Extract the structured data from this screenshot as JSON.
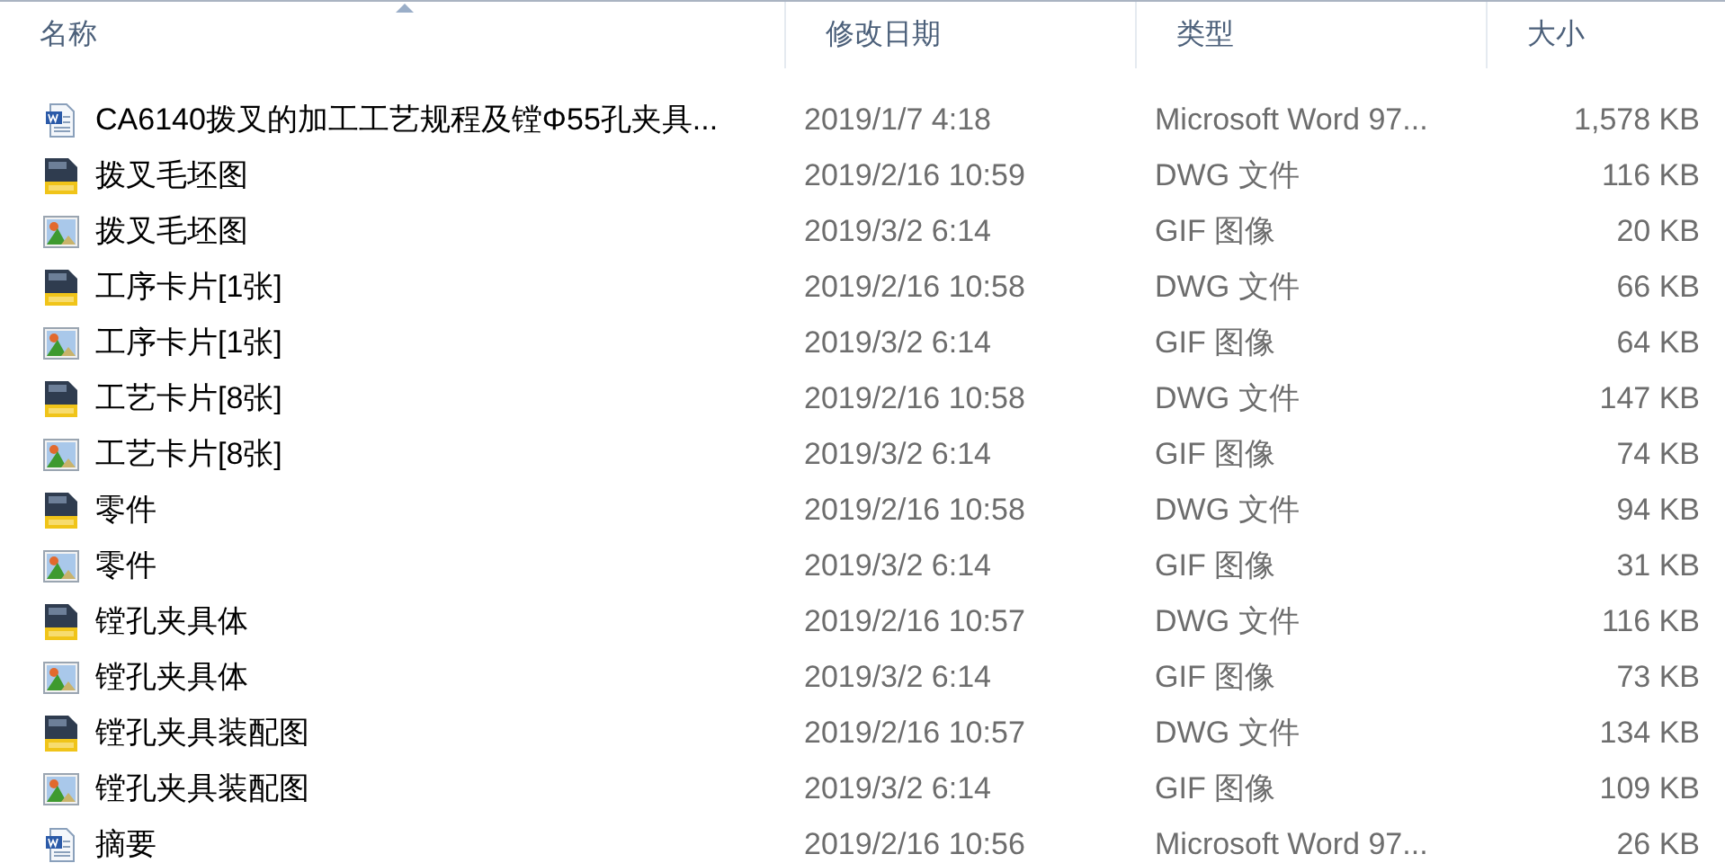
{
  "columns": [
    {
      "label": "名称",
      "sorted": true
    },
    {
      "label": "修改日期",
      "sorted": false
    },
    {
      "label": "类型",
      "sorted": false
    },
    {
      "label": "大小",
      "sorted": false
    }
  ],
  "files": [
    {
      "kind": "word",
      "name": "CA6140拨叉的加工工艺规程及镗Φ55孔夹具...",
      "date": "2019/1/7 4:18",
      "type": "Microsoft Word 97...",
      "size": "1,578 KB"
    },
    {
      "kind": "dwg",
      "name": "拨叉毛坯图",
      "date": "2019/2/16 10:59",
      "type": "DWG 文件",
      "size": "116 KB"
    },
    {
      "kind": "gif",
      "name": "拨叉毛坯图",
      "date": "2019/3/2 6:14",
      "type": "GIF 图像",
      "size": "20 KB"
    },
    {
      "kind": "dwg",
      "name": "工序卡片[1张]",
      "date": "2019/2/16 10:58",
      "type": "DWG 文件",
      "size": "66 KB"
    },
    {
      "kind": "gif",
      "name": "工序卡片[1张]",
      "date": "2019/3/2 6:14",
      "type": "GIF 图像",
      "size": "64 KB"
    },
    {
      "kind": "dwg",
      "name": "工艺卡片[8张]",
      "date": "2019/2/16 10:58",
      "type": "DWG 文件",
      "size": "147 KB"
    },
    {
      "kind": "gif",
      "name": "工艺卡片[8张]",
      "date": "2019/3/2 6:14",
      "type": "GIF 图像",
      "size": "74 KB"
    },
    {
      "kind": "dwg",
      "name": "零件",
      "date": "2019/2/16 10:58",
      "type": "DWG 文件",
      "size": "94 KB"
    },
    {
      "kind": "gif",
      "name": "零件",
      "date": "2019/3/2 6:14",
      "type": "GIF 图像",
      "size": "31 KB"
    },
    {
      "kind": "dwg",
      "name": "镗孔夹具体",
      "date": "2019/2/16 10:57",
      "type": "DWG 文件",
      "size": "116 KB"
    },
    {
      "kind": "gif",
      "name": "镗孔夹具体",
      "date": "2019/3/2 6:14",
      "type": "GIF 图像",
      "size": "73 KB"
    },
    {
      "kind": "dwg",
      "name": "镗孔夹具装配图",
      "date": "2019/2/16 10:57",
      "type": "DWG 文件",
      "size": "134 KB"
    },
    {
      "kind": "gif",
      "name": "镗孔夹具装配图",
      "date": "2019/3/2 6:14",
      "type": "GIF 图像",
      "size": "109 KB"
    },
    {
      "kind": "word",
      "name": "摘要",
      "date": "2019/2/16 10:56",
      "type": "Microsoft Word 97...",
      "size": "26 KB"
    }
  ]
}
